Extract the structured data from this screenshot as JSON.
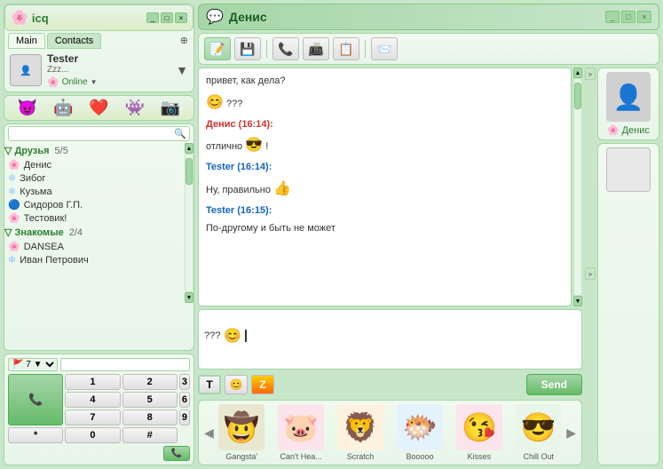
{
  "left": {
    "icq_logo": "icq",
    "logo_icon": "🌸",
    "win_btns": [
      "_",
      "□",
      "×"
    ],
    "tabs": [
      {
        "label": "Main",
        "active": true
      },
      {
        "label": "Contacts",
        "active": false
      }
    ],
    "user": {
      "name": "Tester",
      "status_text": "Zzz...",
      "status": "Online",
      "avatar_placeholder": "👤"
    },
    "mood_icons": [
      "😈",
      "🤖",
      "❤️",
      "👾",
      "📷"
    ],
    "search_placeholder": "",
    "groups": [
      {
        "name": "Друзья",
        "count": "5/5",
        "contacts": [
          {
            "name": "Денис",
            "icon": "flower"
          },
          {
            "name": "Зибог",
            "icon": "snowflake"
          },
          {
            "name": "Кузьма",
            "icon": "snowflake"
          },
          {
            "name": "Сидоров Г.П.",
            "icon": "special"
          },
          {
            "name": "Тестовик!",
            "icon": "flower"
          }
        ]
      },
      {
        "name": "Знакомые",
        "count": "2/4",
        "contacts": [
          {
            "name": "DANSEA",
            "icon": "flower"
          },
          {
            "name": "Иван Петрович",
            "icon": "snowflake"
          }
        ]
      }
    ],
    "dialer": {
      "country": "7",
      "phone": "",
      "buttons": [
        "1",
        "2",
        "3",
        "4",
        "5",
        "6",
        "7",
        "8",
        "9",
        "*",
        "0",
        "#"
      ]
    }
  },
  "chat": {
    "title": "Денис",
    "title_icon": "💬",
    "win_btns": [
      "_",
      "□",
      "×"
    ],
    "toolbar_btns": [
      "📝",
      "💾",
      "📞",
      "📠",
      "📋",
      "📨"
    ],
    "messages": [
      {
        "type": "text",
        "text": "привет, как дела?"
      },
      {
        "type": "emoji+text",
        "emoji": "😊",
        "text": "???"
      },
      {
        "type": "sender",
        "sender": "Денис (16:14):",
        "color": "red"
      },
      {
        "type": "emoji+text",
        "emoji": "😎",
        "text": "отлично",
        "suffix": "!"
      },
      {
        "type": "sender",
        "sender": "Tester (16:14):",
        "color": "blue"
      },
      {
        "type": "emoji+text",
        "text": "Ну, правильно",
        "emoji": "👍"
      },
      {
        "type": "sender",
        "sender": "Tester (16:15):",
        "color": "blue"
      },
      {
        "type": "text",
        "text": "По-другому и быть не может"
      }
    ],
    "input_text": "???",
    "input_emoji": "😊",
    "format_btns": [
      "T",
      "😊",
      "Z"
    ],
    "send_label": "Send",
    "contact_name": "Денис",
    "contact_avatar": "👤",
    "stickers": [
      {
        "label": "Gangsta'",
        "emoji": "🤠",
        "bg": "s-gangsta"
      },
      {
        "label": "Can't Hea...",
        "emoji": "🐷",
        "bg": "s-canthear"
      },
      {
        "label": "Scratch",
        "emoji": "🦁",
        "bg": "s-scratch"
      },
      {
        "label": "Booooo",
        "emoji": "🐡",
        "bg": "s-booooo"
      },
      {
        "label": "Kisses",
        "emoji": "😘",
        "bg": "s-kisses"
      },
      {
        "label": "Chill Out",
        "emoji": "😎",
        "bg": "s-chillout"
      }
    ]
  }
}
